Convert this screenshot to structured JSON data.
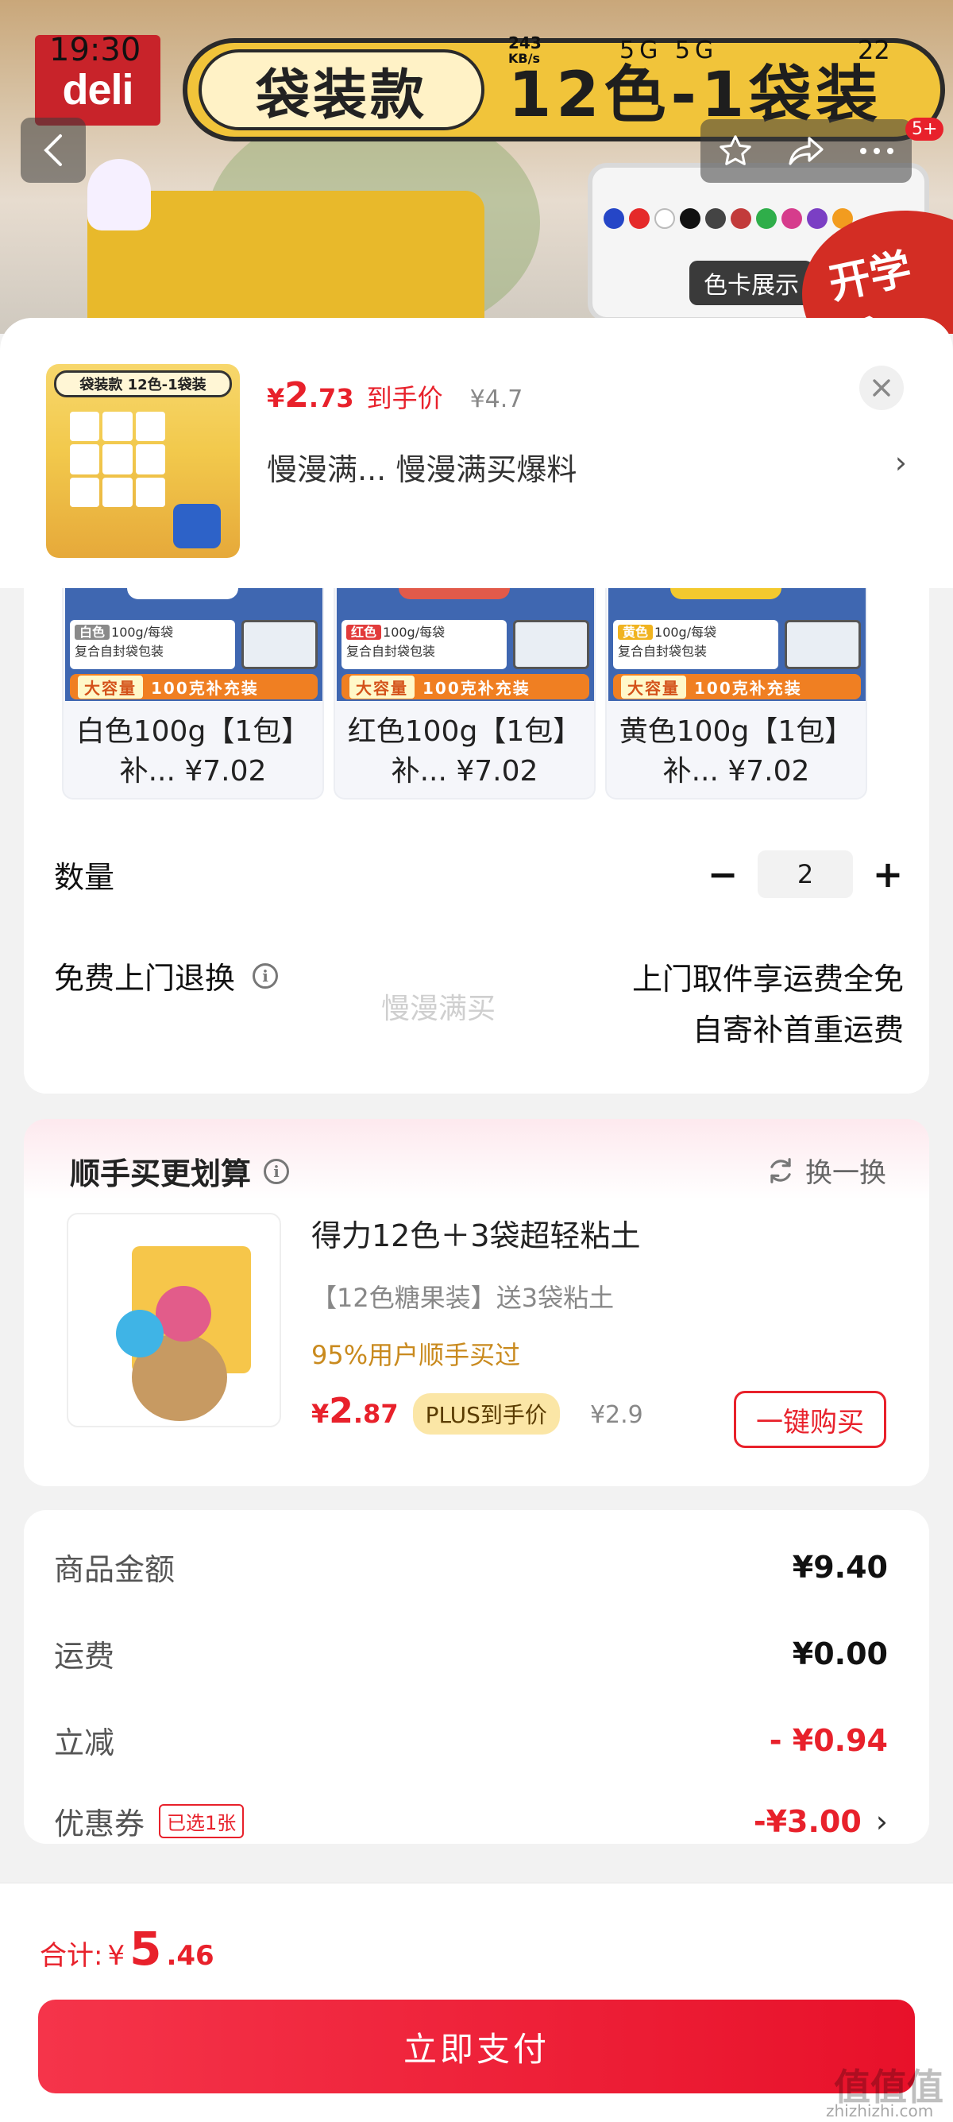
{
  "status_bar": {
    "time": "19:30",
    "net_speed": "243",
    "net_unit": "KB/s",
    "icons": "5G 5G",
    "battery": "22"
  },
  "banner": {
    "brand": "deli",
    "title_left": "袋装款",
    "title_right": "12色-1袋装",
    "card_label": "色卡展示",
    "season": "开学季",
    "swatch_colors": [
      "#2546c7",
      "#e52a2a",
      "#ffffff",
      "#111111",
      "#444444",
      "#c23b3b",
      "#2fae4a",
      "#d63c8c",
      "#7b3fc4",
      "#f29c1f"
    ]
  },
  "nav": {
    "badge": "5+"
  },
  "product": {
    "thumb_title": "袋装款 12色-1袋装",
    "price_currency": "¥",
    "price_int": "2",
    "price_dec": ".73",
    "price_tag": "到手价",
    "orig_price": "¥4.7",
    "spec_text": "慢漫满...  慢漫满买爆料"
  },
  "variants": [
    {
      "color_tag": "白色",
      "tag_color": "#8a8a8a",
      "spec": "100g/每袋",
      "pack": "复合自封袋包装",
      "band_tag": "大容量",
      "band_text": "100克补充装",
      "name_line1": "白色100g【1包】",
      "name_line2": "补... ¥7.02",
      "top_color": "#ffffff"
    },
    {
      "color_tag": "红色",
      "tag_color": "#e23b3b",
      "spec": "100g/每袋",
      "pack": "复合自封袋包装",
      "band_tag": "大容量",
      "band_text": "100克补充装",
      "name_line1": "红色100g【1包】",
      "name_line2": "补... ¥7.02",
      "top_color": "#e25a4a"
    },
    {
      "color_tag": "黄色",
      "tag_color": "#f0b31f",
      "spec": "100g/每袋",
      "pack": "复合自封袋包装",
      "band_tag": "大容量",
      "band_text": "100克补充装",
      "name_line1": "黄色100g【1包】",
      "name_line2": "补... ¥7.02",
      "top_color": "#f3c92e"
    }
  ],
  "quantity": {
    "label": "数量",
    "value": "2",
    "minus": "−",
    "plus": "+"
  },
  "returns": {
    "label": "免费上门退换",
    "line1": "上门取件享运费全免",
    "line2": "自寄补首重运费"
  },
  "watermark": "慢漫满买",
  "recommend": {
    "title": "顺手买更划算",
    "swap": "换一换",
    "name": "得力12色＋3袋超轻粘土",
    "desc": "【12色糖果装】送3袋粘土",
    "social": "95%用户顺手买过",
    "price_currency": "¥",
    "price_int": "2",
    "price_dec": ".87",
    "plus_tag": "PLUS到手价",
    "orig_price": "¥2.9",
    "buy_label": "一键购买"
  },
  "summary": {
    "rows": [
      {
        "key": "商品金额",
        "value": "¥9.40"
      },
      {
        "key": "运费",
        "value": "¥0.00"
      },
      {
        "key": "立减",
        "value": "- ¥0.94"
      },
      {
        "key": "优惠券",
        "tag": "已选1张",
        "value": "-¥3.00"
      }
    ]
  },
  "footer": {
    "total_label": "合计:",
    "total_currency": "¥",
    "total_int": "5",
    "total_dec": ".46",
    "pay_label": "立即支付",
    "site_mark": "值值值",
    "site_url": "zhizhizhi.com"
  },
  "colors": {
    "accent": "#e8212b",
    "price_orange": "#c98a1e"
  }
}
